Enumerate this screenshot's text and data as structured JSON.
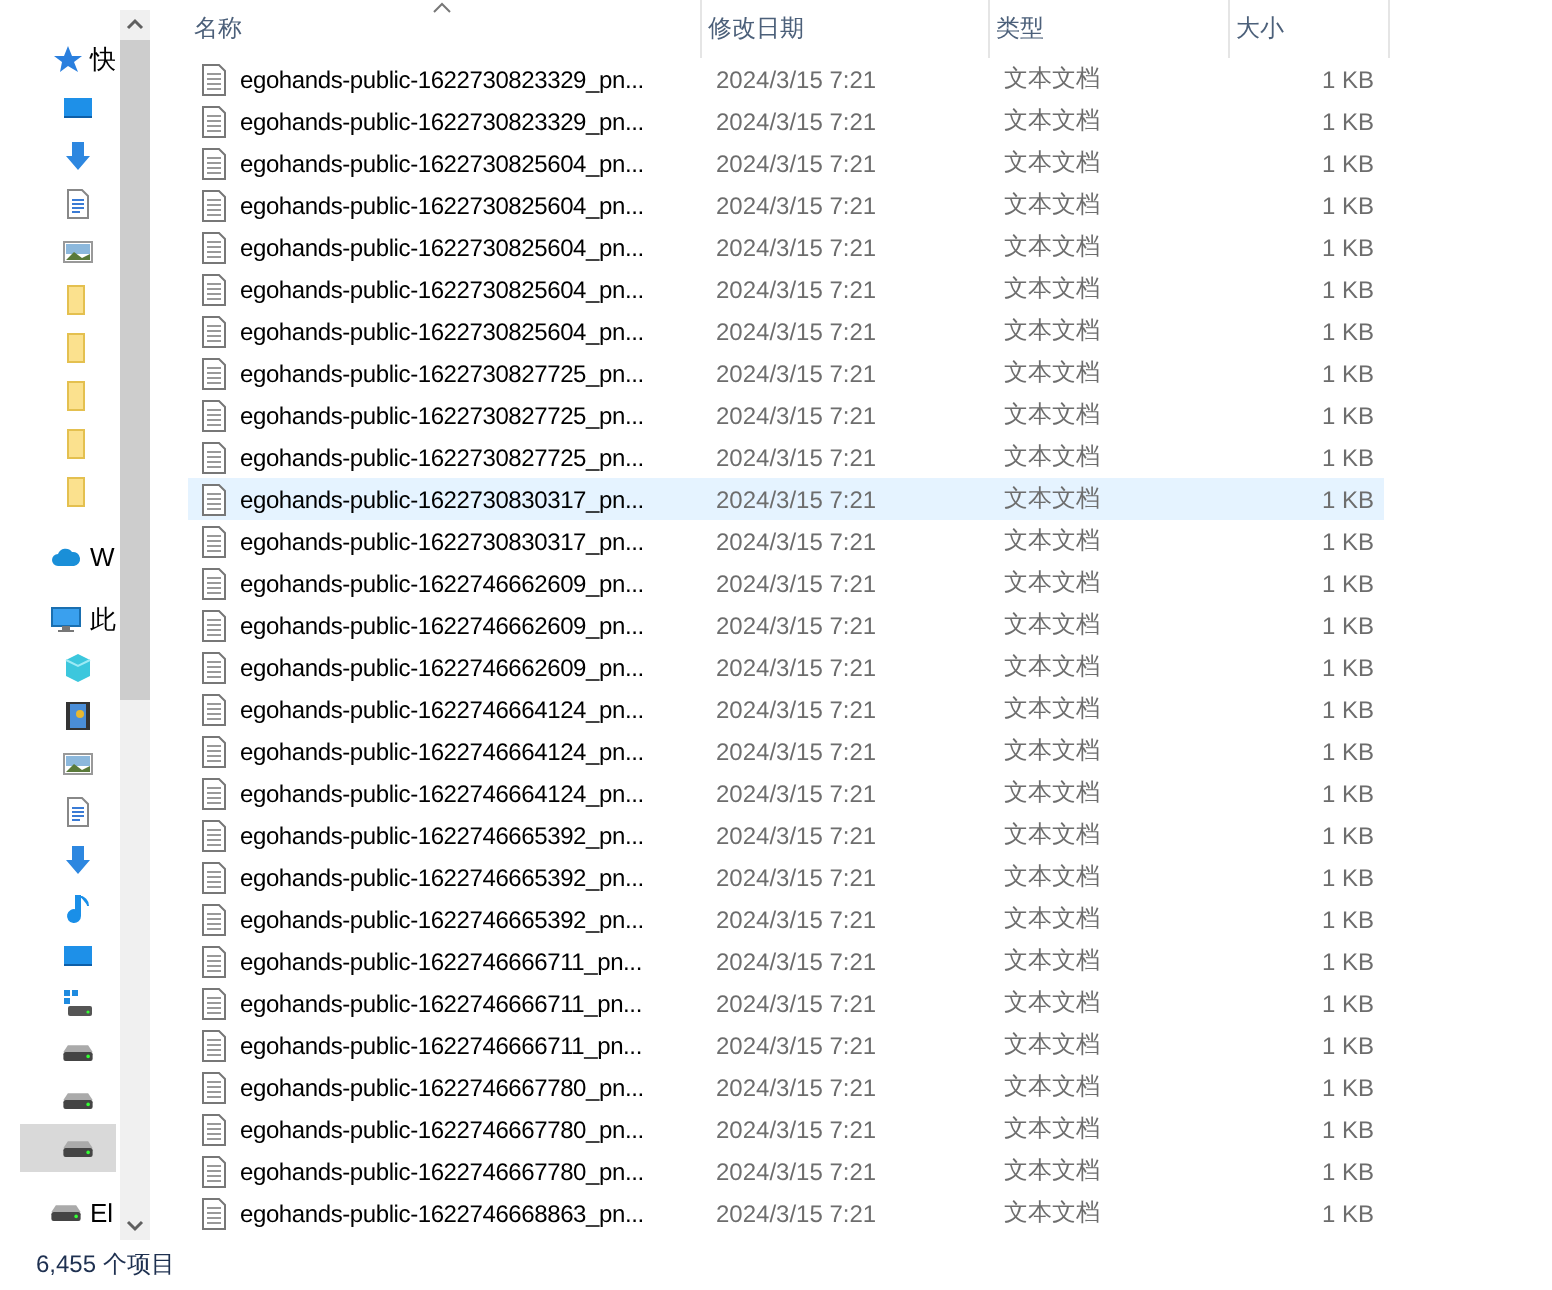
{
  "sidebar": {
    "groups": [
      {
        "kind": "star",
        "label": "快",
        "selected": false,
        "children": [
          {
            "kind": "desktop",
            "selected": false
          },
          {
            "kind": "download",
            "selected": false
          },
          {
            "kind": "document",
            "selected": false
          },
          {
            "kind": "picture",
            "selected": false
          },
          {
            "kind": "folder",
            "selected": false
          },
          {
            "kind": "folder",
            "selected": false
          },
          {
            "kind": "folder",
            "selected": false
          },
          {
            "kind": "folder",
            "selected": false
          },
          {
            "kind": "folder",
            "selected": false
          }
        ]
      },
      {
        "kind": "cloud",
        "label": "W",
        "selected": false
      },
      {
        "kind": "pc",
        "label": "此",
        "selected": false,
        "children": [
          {
            "kind": "cube",
            "selected": false
          },
          {
            "kind": "film",
            "selected": false
          },
          {
            "kind": "picture",
            "selected": false
          },
          {
            "kind": "document",
            "selected": false
          },
          {
            "kind": "download",
            "selected": false
          },
          {
            "kind": "music",
            "selected": false
          },
          {
            "kind": "desktop",
            "selected": false
          },
          {
            "kind": "windrive",
            "selected": false
          },
          {
            "kind": "drive",
            "selected": false
          },
          {
            "kind": "drive",
            "selected": false
          },
          {
            "kind": "drive",
            "selected": true
          }
        ]
      },
      {
        "kind": "drive",
        "label": "El",
        "selected": false
      }
    ]
  },
  "table": {
    "columns": [
      "名称",
      "修改日期",
      "类型",
      "大小"
    ],
    "rows": [
      {
        "name": "egohands-public-1622730823329_pn...",
        "date": "2024/3/15 7:21",
        "type": "文本文档",
        "size": "1 KB",
        "selected": false
      },
      {
        "name": "egohands-public-1622730823329_pn...",
        "date": "2024/3/15 7:21",
        "type": "文本文档",
        "size": "1 KB",
        "selected": false
      },
      {
        "name": "egohands-public-1622730825604_pn...",
        "date": "2024/3/15 7:21",
        "type": "文本文档",
        "size": "1 KB",
        "selected": false
      },
      {
        "name": "egohands-public-1622730825604_pn...",
        "date": "2024/3/15 7:21",
        "type": "文本文档",
        "size": "1 KB",
        "selected": false
      },
      {
        "name": "egohands-public-1622730825604_pn...",
        "date": "2024/3/15 7:21",
        "type": "文本文档",
        "size": "1 KB",
        "selected": false
      },
      {
        "name": "egohands-public-1622730825604_pn...",
        "date": "2024/3/15 7:21",
        "type": "文本文档",
        "size": "1 KB",
        "selected": false
      },
      {
        "name": "egohands-public-1622730825604_pn...",
        "date": "2024/3/15 7:21",
        "type": "文本文档",
        "size": "1 KB",
        "selected": false
      },
      {
        "name": "egohands-public-1622730827725_pn...",
        "date": "2024/3/15 7:21",
        "type": "文本文档",
        "size": "1 KB",
        "selected": false
      },
      {
        "name": "egohands-public-1622730827725_pn...",
        "date": "2024/3/15 7:21",
        "type": "文本文档",
        "size": "1 KB",
        "selected": false
      },
      {
        "name": "egohands-public-1622730827725_pn...",
        "date": "2024/3/15 7:21",
        "type": "文本文档",
        "size": "1 KB",
        "selected": false
      },
      {
        "name": "egohands-public-1622730830317_pn...",
        "date": "2024/3/15 7:21",
        "type": "文本文档",
        "size": "1 KB",
        "selected": true
      },
      {
        "name": "egohands-public-1622730830317_pn...",
        "date": "2024/3/15 7:21",
        "type": "文本文档",
        "size": "1 KB",
        "selected": false
      },
      {
        "name": "egohands-public-1622746662609_pn...",
        "date": "2024/3/15 7:21",
        "type": "文本文档",
        "size": "1 KB",
        "selected": false
      },
      {
        "name": "egohands-public-1622746662609_pn...",
        "date": "2024/3/15 7:21",
        "type": "文本文档",
        "size": "1 KB",
        "selected": false
      },
      {
        "name": "egohands-public-1622746662609_pn...",
        "date": "2024/3/15 7:21",
        "type": "文本文档",
        "size": "1 KB",
        "selected": false
      },
      {
        "name": "egohands-public-1622746664124_pn...",
        "date": "2024/3/15 7:21",
        "type": "文本文档",
        "size": "1 KB",
        "selected": false
      },
      {
        "name": "egohands-public-1622746664124_pn...",
        "date": "2024/3/15 7:21",
        "type": "文本文档",
        "size": "1 KB",
        "selected": false
      },
      {
        "name": "egohands-public-1622746664124_pn...",
        "date": "2024/3/15 7:21",
        "type": "文本文档",
        "size": "1 KB",
        "selected": false
      },
      {
        "name": "egohands-public-1622746665392_pn...",
        "date": "2024/3/15 7:21",
        "type": "文本文档",
        "size": "1 KB",
        "selected": false
      },
      {
        "name": "egohands-public-1622746665392_pn...",
        "date": "2024/3/15 7:21",
        "type": "文本文档",
        "size": "1 KB",
        "selected": false
      },
      {
        "name": "egohands-public-1622746665392_pn...",
        "date": "2024/3/15 7:21",
        "type": "文本文档",
        "size": "1 KB",
        "selected": false
      },
      {
        "name": "egohands-public-1622746666711_pn...",
        "date": "2024/3/15 7:21",
        "type": "文本文档",
        "size": "1 KB",
        "selected": false
      },
      {
        "name": "egohands-public-1622746666711_pn...",
        "date": "2024/3/15 7:21",
        "type": "文本文档",
        "size": "1 KB",
        "selected": false
      },
      {
        "name": "egohands-public-1622746666711_pn...",
        "date": "2024/3/15 7:21",
        "type": "文本文档",
        "size": "1 KB",
        "selected": false
      },
      {
        "name": "egohands-public-1622746667780_pn...",
        "date": "2024/3/15 7:21",
        "type": "文本文档",
        "size": "1 KB",
        "selected": false
      },
      {
        "name": "egohands-public-1622746667780_pn...",
        "date": "2024/3/15 7:21",
        "type": "文本文档",
        "size": "1 KB",
        "selected": false
      },
      {
        "name": "egohands-public-1622746667780_pn...",
        "date": "2024/3/15 7:21",
        "type": "文本文档",
        "size": "1 KB",
        "selected": false
      },
      {
        "name": "egohands-public-1622746668863_pn...",
        "date": "2024/3/15 7:21",
        "type": "文本文档",
        "size": "1 KB",
        "selected": false
      }
    ]
  },
  "status_bar": {
    "count": "6,455 个项目"
  }
}
